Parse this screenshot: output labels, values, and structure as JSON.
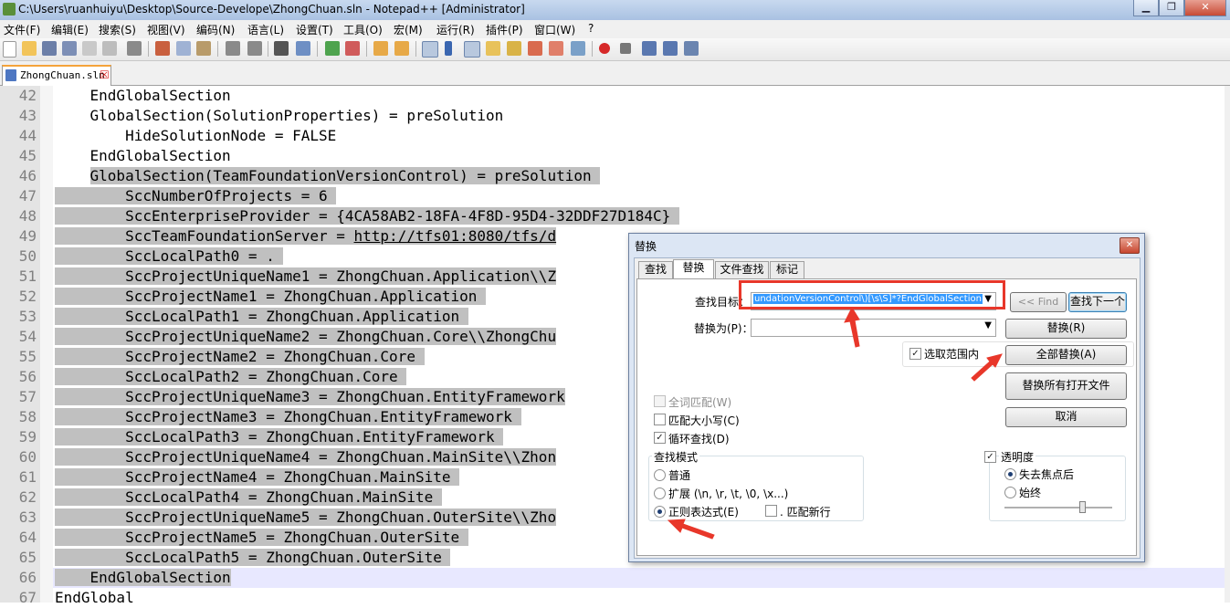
{
  "window": {
    "title": "C:\\Users\\ruanhuiyu\\Desktop\\Source-Develope\\ZhongChuan.sln - Notepad++ [Administrator]"
  },
  "menu": [
    "文件(F)",
    "编辑(E)",
    "搜索(S)",
    "视图(V)",
    "编码(N)",
    "语言(L)",
    "设置(T)",
    "工具(O)",
    "宏(M)",
    "运行(R)",
    "插件(P)",
    "窗口(W)",
    "?"
  ],
  "tab": {
    "label": "ZhongChuan.sln"
  },
  "lines": [
    {
      "num": "42",
      "text": "    EndGlobalSection",
      "sel": false
    },
    {
      "num": "43",
      "text": "    GlobalSection(SolutionProperties) = preSolution",
      "sel": false
    },
    {
      "num": "44",
      "text": "        HideSolutionNode = FALSE",
      "sel": false
    },
    {
      "num": "45",
      "text": "    EndGlobalSection",
      "sel": false
    },
    {
      "num": "46",
      "text": "    GlobalSection(TeamFoundationVersionControl) = preSolution ",
      "sel": true,
      "selStart": 4
    },
    {
      "num": "47",
      "text": "        SccNumberOfProjects = 6 ",
      "sel": true
    },
    {
      "num": "48",
      "text": "        SccEnterpriseProvider = {4CA58AB2-18FA-4F8D-95D4-32DDF27D184C} ",
      "sel": true
    },
    {
      "num": "49",
      "text": "        SccTeamFoundationServer = http://tfs01:8080/tfs/d",
      "sel": true,
      "url": "http://tfs01:8080/tfs/d"
    },
    {
      "num": "50",
      "text": "        SccLocalPath0 = . ",
      "sel": true
    },
    {
      "num": "51",
      "text": "        SccProjectUniqueName1 = ZhongChuan.Application\\\\Z",
      "sel": true
    },
    {
      "num": "52",
      "text": "        SccProjectName1 = ZhongChuan.Application ",
      "sel": true
    },
    {
      "num": "53",
      "text": "        SccLocalPath1 = ZhongChuan.Application ",
      "sel": true
    },
    {
      "num": "54",
      "text": "        SccProjectUniqueName2 = ZhongChuan.Core\\\\ZhongChu",
      "sel": true
    },
    {
      "num": "55",
      "text": "        SccProjectName2 = ZhongChuan.Core ",
      "sel": true
    },
    {
      "num": "56",
      "text": "        SccLocalPath2 = ZhongChuan.Core ",
      "sel": true
    },
    {
      "num": "57",
      "text": "        SccProjectUniqueName3 = ZhongChuan.EntityFramework",
      "sel": true
    },
    {
      "num": "58",
      "text": "        SccProjectName3 = ZhongChuan.EntityFramework ",
      "sel": true
    },
    {
      "num": "59",
      "text": "        SccLocalPath3 = ZhongChuan.EntityFramework ",
      "sel": true
    },
    {
      "num": "60",
      "text": "        SccProjectUniqueName4 = ZhongChuan.MainSite\\\\Zhon",
      "sel": true
    },
    {
      "num": "61",
      "text": "        SccProjectName4 = ZhongChuan.MainSite ",
      "sel": true
    },
    {
      "num": "62",
      "text": "        SccLocalPath4 = ZhongChuan.MainSite ",
      "sel": true
    },
    {
      "num": "63",
      "text": "        SccProjectUniqueName5 = ZhongChuan.OuterSite\\\\Zho",
      "sel": true
    },
    {
      "num": "64",
      "text": "        SccProjectName5 = ZhongChuan.OuterSite ",
      "sel": true
    },
    {
      "num": "65",
      "text": "        SccLocalPath5 = ZhongChuan.OuterSite ",
      "sel": true
    },
    {
      "num": "66",
      "text": "    EndGlobalSection",
      "sel": true,
      "current": true
    },
    {
      "num": "67",
      "text": "EndGlobal",
      "sel": false
    }
  ],
  "dialog": {
    "title": "替换",
    "tabs": [
      "查找",
      "替换",
      "文件查找",
      "标记"
    ],
    "find_label": "查找目标：",
    "find_value": "undationVersionControl\\)[\\s\\S]*?EndGlobalSection",
    "replace_label": "替换为(P)：",
    "replace_value": "",
    "prev_find": "<< Find",
    "find_next": "查找下一个",
    "replace": "替换(R)",
    "replace_all": "全部替换(A)",
    "replace_all_open": "替换所有打开文件",
    "cancel": "取消",
    "in_selection": "选取范围内",
    "whole_word": "全词匹配(W)",
    "match_case": "匹配大小写(C)",
    "wrap": "循环查找(D)",
    "mode_title": "查找模式",
    "mode_normal": "普通",
    "mode_extended": "扩展 (\\n, \\r, \\t, \\0, \\x...)",
    "mode_regex": "正则表达式(E)",
    "dot_newline": ". 匹配新行",
    "transparency": "透明度",
    "on_lose_focus": "失去焦点后",
    "always": "始终"
  },
  "state": {
    "mode": "regex",
    "in_selection": true,
    "wrap": true,
    "match_case": false,
    "whole_word_disabled": true,
    "transparency": true,
    "transparency_when": "on_lose_focus"
  },
  "colors": {
    "selection": "#c0c0c0",
    "annotation": "#e8372a"
  }
}
